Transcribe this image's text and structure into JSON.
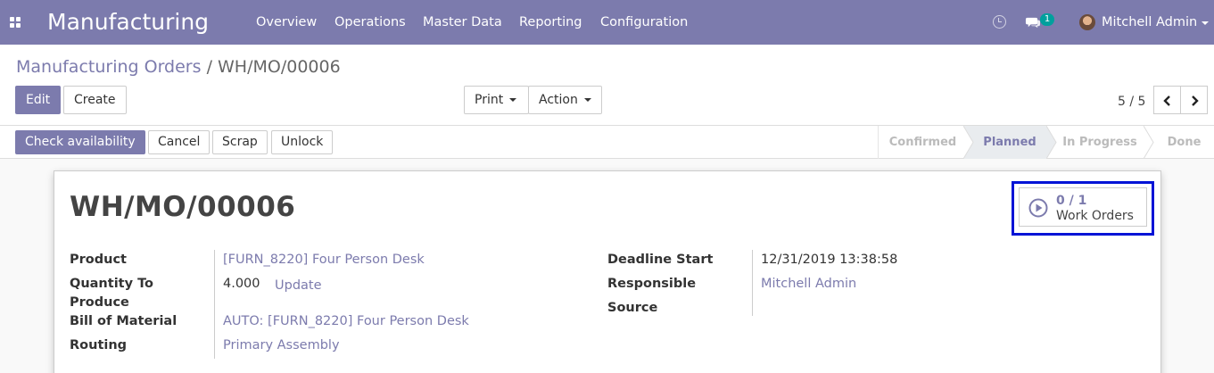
{
  "navbar": {
    "app_name": "Manufacturing",
    "menus": [
      "Overview",
      "Operations",
      "Master Data",
      "Reporting",
      "Configuration"
    ],
    "chat_count": "1",
    "user_name": "Mitchell Admin"
  },
  "breadcrumb": {
    "parent": "Manufacturing Orders",
    "separator": "/",
    "current": "WH/MO/00006"
  },
  "toolbar": {
    "edit_label": "Edit",
    "create_label": "Create",
    "print_label": "Print",
    "action_label": "Action"
  },
  "pager": {
    "value": "5 / 5"
  },
  "statusbar": {
    "buttons": [
      "Check availability",
      "Cancel",
      "Scrap",
      "Unlock"
    ],
    "stages": [
      "Confirmed",
      "Planned",
      "In Progress",
      "Done"
    ],
    "active_stage": "Planned"
  },
  "form": {
    "title": "WH/MO/00006",
    "smart_button": {
      "count": "0 / 1",
      "label": "Work Orders"
    },
    "left_fields": {
      "product_label": "Product",
      "product_value": "[FURN_8220] Four Person Desk",
      "qty_label_1": "Quantity To",
      "qty_label_2": "Produce",
      "qty_value": "4.000",
      "qty_update": "Update",
      "bom_label": "Bill of Material",
      "bom_value": "AUTO: [FURN_8220] Four Person Desk",
      "routing_label": "Routing",
      "routing_value": "Primary Assembly"
    },
    "right_fields": {
      "deadline_label": "Deadline Start",
      "deadline_value": "12/31/2019 13:38:58",
      "responsible_label": "Responsible",
      "responsible_value": "Mitchell Admin",
      "source_label": "Source",
      "source_value": ""
    }
  },
  "colors": {
    "brand": "#7c7bad",
    "highlight": "#0013d6",
    "badge": "#00a09d"
  }
}
